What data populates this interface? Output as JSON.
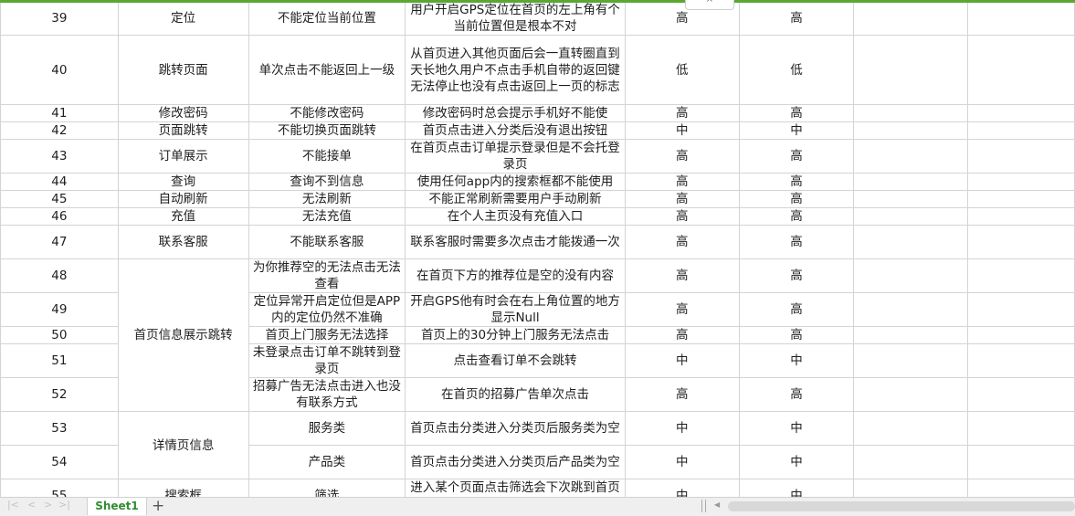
{
  "ui": {
    "collapse_icon": "^"
  },
  "rows": [
    {
      "no": "39",
      "module": "定位",
      "issue": "不能定位当前位置",
      "desc": "用户开启GPS定位在首页的左上角有个当前位置但是根本不对",
      "sev": "高",
      "pri": "高"
    },
    {
      "no": "40",
      "module": "跳转页面",
      "issue": "单次点击不能返回上一级",
      "desc": "从首页进入其他页面后会一直转圈直到天长地久用户不点击手机自带的返回键无法停止也没有点击返回上一页的标志",
      "sev": "低",
      "pri": "低"
    },
    {
      "no": "41",
      "module": "修改密码",
      "issue": "不能修改密码",
      "desc": "修改密码时总会提示手机好不能使",
      "sev": "高",
      "pri": "高"
    },
    {
      "no": "42",
      "module": "页面跳转",
      "issue": "不能切换页面跳转",
      "desc": "首页点击进入分类后没有退出按钮",
      "sev": "中",
      "pri": "中"
    },
    {
      "no": "43",
      "module": "订单展示",
      "issue": "不能接单",
      "desc": "在首页点击订单提示登录但是不会托登录页",
      "sev": "高",
      "pri": "高"
    },
    {
      "no": "44",
      "module": "查询",
      "issue": "查询不到信息",
      "desc": "使用任何app内的搜索框都不能使用",
      "sev": "高",
      "pri": "高"
    },
    {
      "no": "45",
      "module": "自动刷新",
      "issue": "无法刷新",
      "desc": "不能正常刷新需要用户手动刷新",
      "sev": "高",
      "pri": "高"
    },
    {
      "no": "46",
      "module": "充值",
      "issue": "无法充值",
      "desc": "在个人主页没有充值入口",
      "sev": "高",
      "pri": "高"
    },
    {
      "no": "47",
      "module": "联系客服",
      "issue": "不能联系客服",
      "desc": "联系客服时需要多次点击才能拨通一次",
      "sev": "高",
      "pri": "高"
    },
    {
      "no": "48",
      "module": "首页信息展示跳转",
      "issue": "为你推荐空的无法点击无法查看",
      "desc": "在首页下方的推荐位是空的没有内容",
      "sev": "高",
      "pri": "高"
    },
    {
      "no": "49",
      "module": "",
      "issue": "定位异常开启定位但是APP内的定位仍然不准确",
      "desc": "开启GPS他有时会在右上角位置的地方显示Null",
      "sev": "高",
      "pri": "高"
    },
    {
      "no": "50",
      "module": "",
      "issue": "首页上门服务无法选择",
      "desc": "首页上的30分钟上门服务无法点击",
      "sev": "高",
      "pri": "高"
    },
    {
      "no": "51",
      "module": "",
      "issue": "未登录点击订单不跳转到登录页",
      "desc": "点击查看订单不会跳转",
      "sev": "中",
      "pri": "中"
    },
    {
      "no": "52",
      "module": "",
      "issue": "招募广告无法点击进入也没有联系方式",
      "desc": "在首页的招募广告单次点击",
      "sev": "高",
      "pri": "高"
    },
    {
      "no": "53",
      "module": "详情页信息",
      "issue": "服务类",
      "desc": "首页点击分类进入分类页后服务类为空",
      "sev": "中",
      "pri": "中"
    },
    {
      "no": "54",
      "module": "",
      "issue": "产品类",
      "desc": "首页点击分类进入分类页后产品类为空",
      "sev": "中",
      "pri": "中"
    },
    {
      "no": "55",
      "module": "搜索框",
      "issue": "筛选",
      "desc": "进入某个页面点击筛选会下次跳到首页的搜索框",
      "sev": "中",
      "pri": "中"
    }
  ],
  "tabs": {
    "sheet1": "Sheet1",
    "add_icon": "+"
  },
  "nav": {
    "first": "|<",
    "prev": "<",
    "next": ">",
    "last": ">|",
    "scroll_left": "◀"
  }
}
